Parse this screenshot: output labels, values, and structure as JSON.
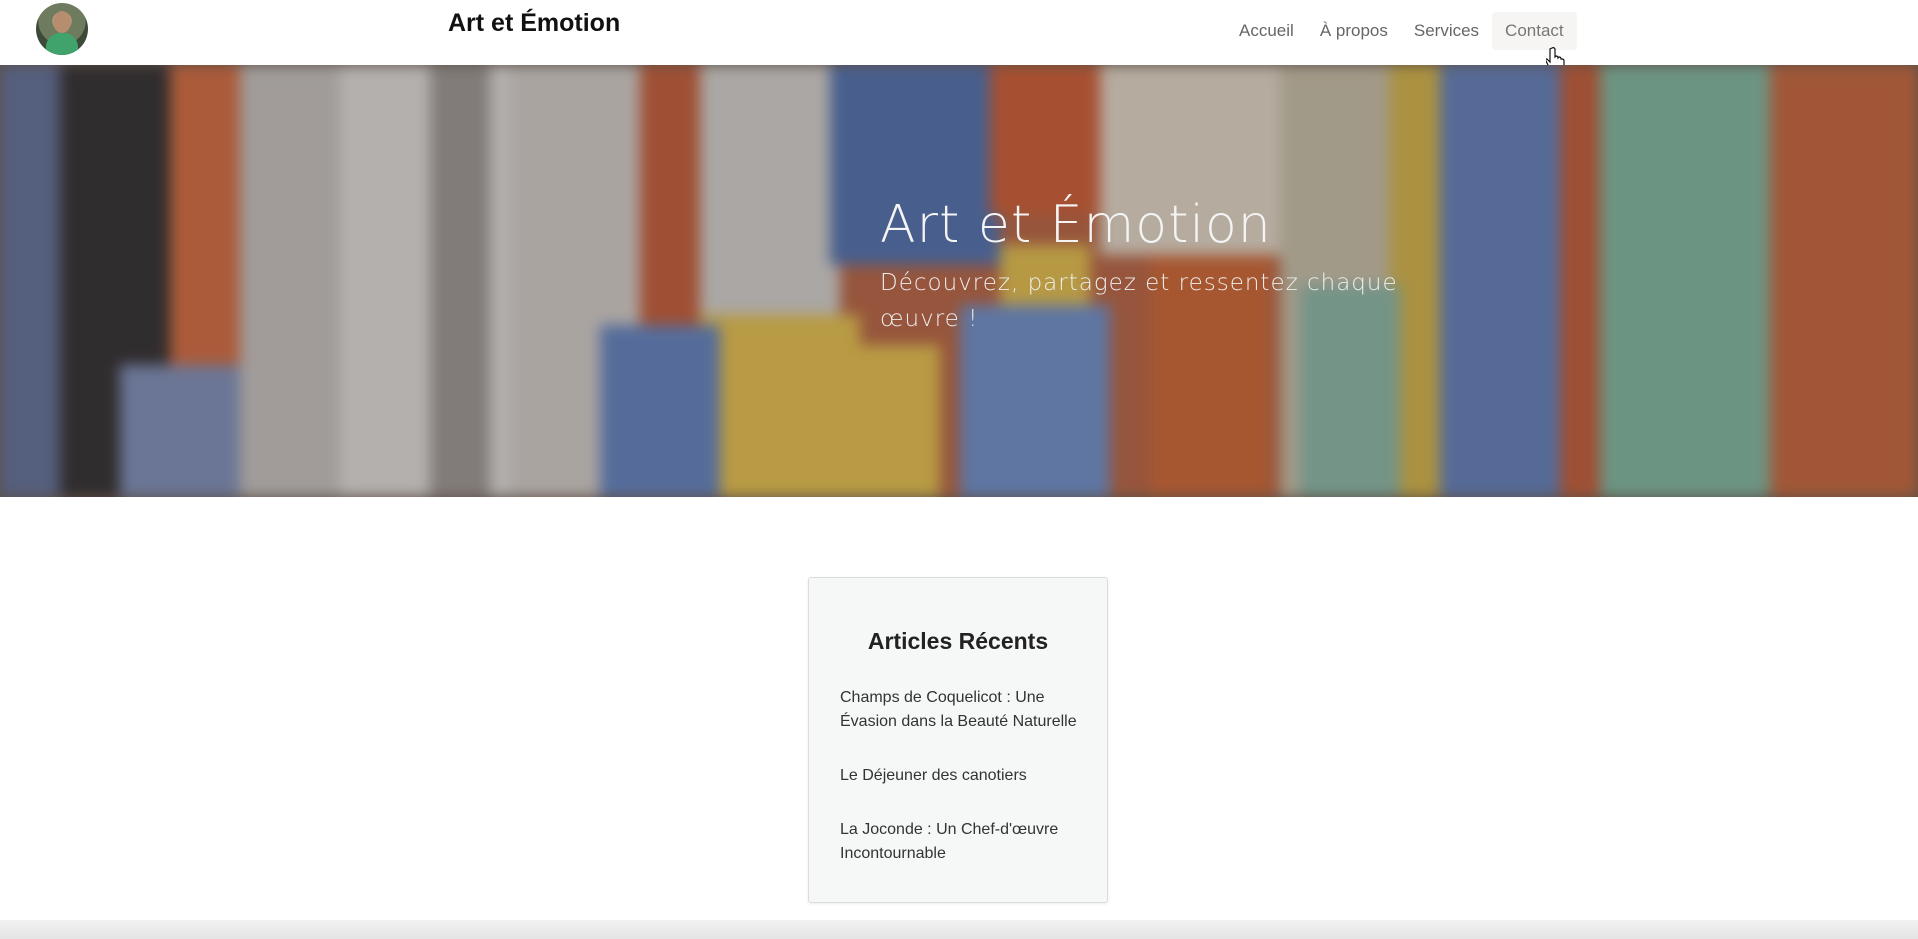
{
  "header": {
    "site_title": "Art et Émotion",
    "nav": [
      {
        "label": "Accueil"
      },
      {
        "label": "À propos"
      },
      {
        "label": "Services"
      },
      {
        "label": "Contact"
      }
    ]
  },
  "hero": {
    "title": "Art et Émotion",
    "subtitle": "Découvrez, partagez et ressentez chaque œuvre !"
  },
  "articles": {
    "title": "Articles Récents",
    "items": [
      {
        "label": "Champs de Coquelicot : Une Évasion dans la Beauté Naturelle"
      },
      {
        "label": "Le Déjeuner des canotiers"
      },
      {
        "label": "La Joconde : Un Chef-d'œuvre Incontournable"
      }
    ]
  },
  "icons": [
    "avatar",
    "hand-pointer-cursor-icon"
  ],
  "colors": {
    "nav_text": "#666666",
    "active_nav_bg": "#f7f4f4",
    "card_bg": "#f6f7f7"
  }
}
